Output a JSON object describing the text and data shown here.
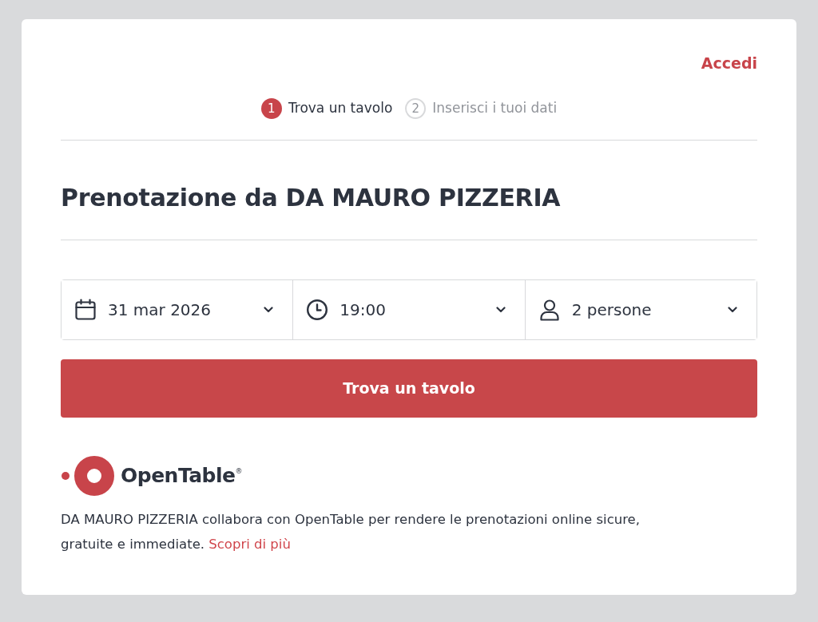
{
  "header": {
    "login_link": "Accedi"
  },
  "steps": [
    {
      "number": "1",
      "label": "Trova un tavolo",
      "selected": true
    },
    {
      "number": "2",
      "label": "Inserisci i tuoi dati",
      "selected": false
    }
  ],
  "title": "Prenotazione da DA MAURO PIZZERIA",
  "selectors": [
    {
      "kind": "date",
      "value": "31 mar 2026"
    },
    {
      "kind": "time",
      "value": "19:00"
    },
    {
      "kind": "party",
      "value": "2 persone"
    }
  ],
  "submit_button": "Trova un tavolo",
  "footer": {
    "logo_text": "OpenTable$^{®}$",
    "description": "DA MAURO PIZZERIA collabora con OpenTable per rendere le prenotazioni online sicure, gratuite e immediate.",
    "link": "Scopri di più"
  }
}
